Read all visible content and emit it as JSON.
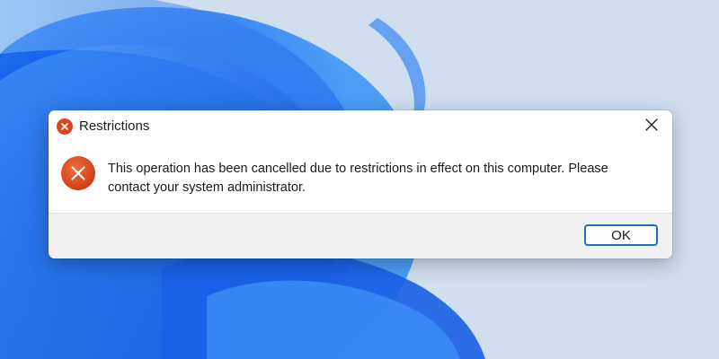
{
  "desktop": {
    "wallpaper_icon": "windows-11-bloom-wallpaper"
  },
  "dialog": {
    "title": "Restrictions",
    "title_icon": "error-icon",
    "close_icon": "close-icon",
    "message_icon": "error-icon",
    "message": "This operation has been cancelled due to restrictions in effect on this computer. Please contact your system administrator.",
    "ok_label": "OK",
    "colors": {
      "error_icon": "#d9471f",
      "button_border": "#1f6fc7",
      "footer_bg": "#f0f0f0"
    }
  }
}
